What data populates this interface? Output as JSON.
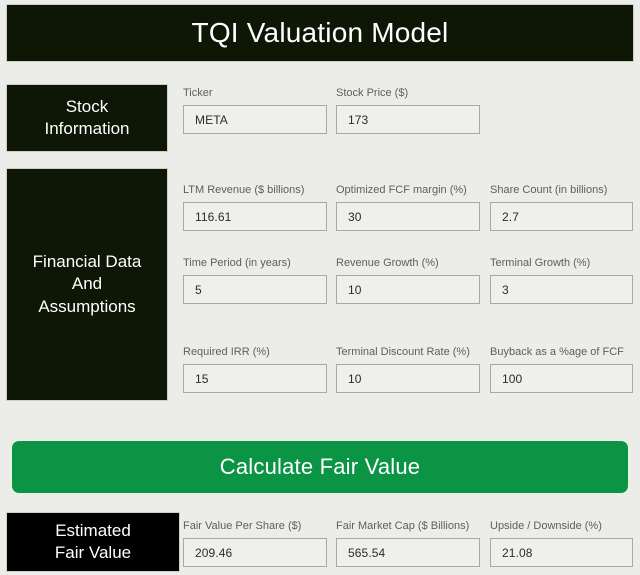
{
  "app": {
    "title": "TQI Valuation Model",
    "accent_green": "#0b9444",
    "header_dark": "#0e1605",
    "result_black": "#000000",
    "page_background": "#ecece8"
  },
  "sections": {
    "stock_information": {
      "label": "Stock\nInformation",
      "label_line1": "Stock",
      "label_line2": "Information",
      "fields": [
        {
          "label": "Ticker",
          "value": "META"
        },
        {
          "label": "Stock Price ($)",
          "value": "173"
        }
      ]
    },
    "financial_data": {
      "label_line1": "Financial Data",
      "label_line2": "And",
      "label_line3": "Assumptions",
      "row1": [
        {
          "label": "LTM Revenue ($ billions)",
          "value": "116.61"
        },
        {
          "label": "Optimized FCF margin (%)",
          "value": "30"
        },
        {
          "label": "Share Count (in billions)",
          "value": "2.7"
        }
      ],
      "row2": [
        {
          "label": "Time Period (in years)",
          "value": "5"
        },
        {
          "label": "Revenue Growth (%)",
          "value": "10"
        },
        {
          "label": "Terminal Growth (%)",
          "value": "3"
        }
      ],
      "row3": [
        {
          "label": "Required IRR (%)",
          "value": "15"
        },
        {
          "label": "Terminal Discount Rate (%)",
          "value": "10"
        },
        {
          "label": "Buyback as a %age of FCF",
          "value": "100"
        }
      ]
    },
    "estimated_fair_value": {
      "label_line1": "Estimated",
      "label_line2": "Fair Value",
      "results": [
        {
          "label": "Fair Value Per Share ($)",
          "value": "209.46"
        },
        {
          "label": "Fair Market Cap ($ Billions)",
          "value": "565.54"
        },
        {
          "label": "Upside / Downside (%)",
          "value": "21.08"
        }
      ]
    }
  },
  "actions": {
    "calculate_label": "Calculate Fair Value"
  }
}
